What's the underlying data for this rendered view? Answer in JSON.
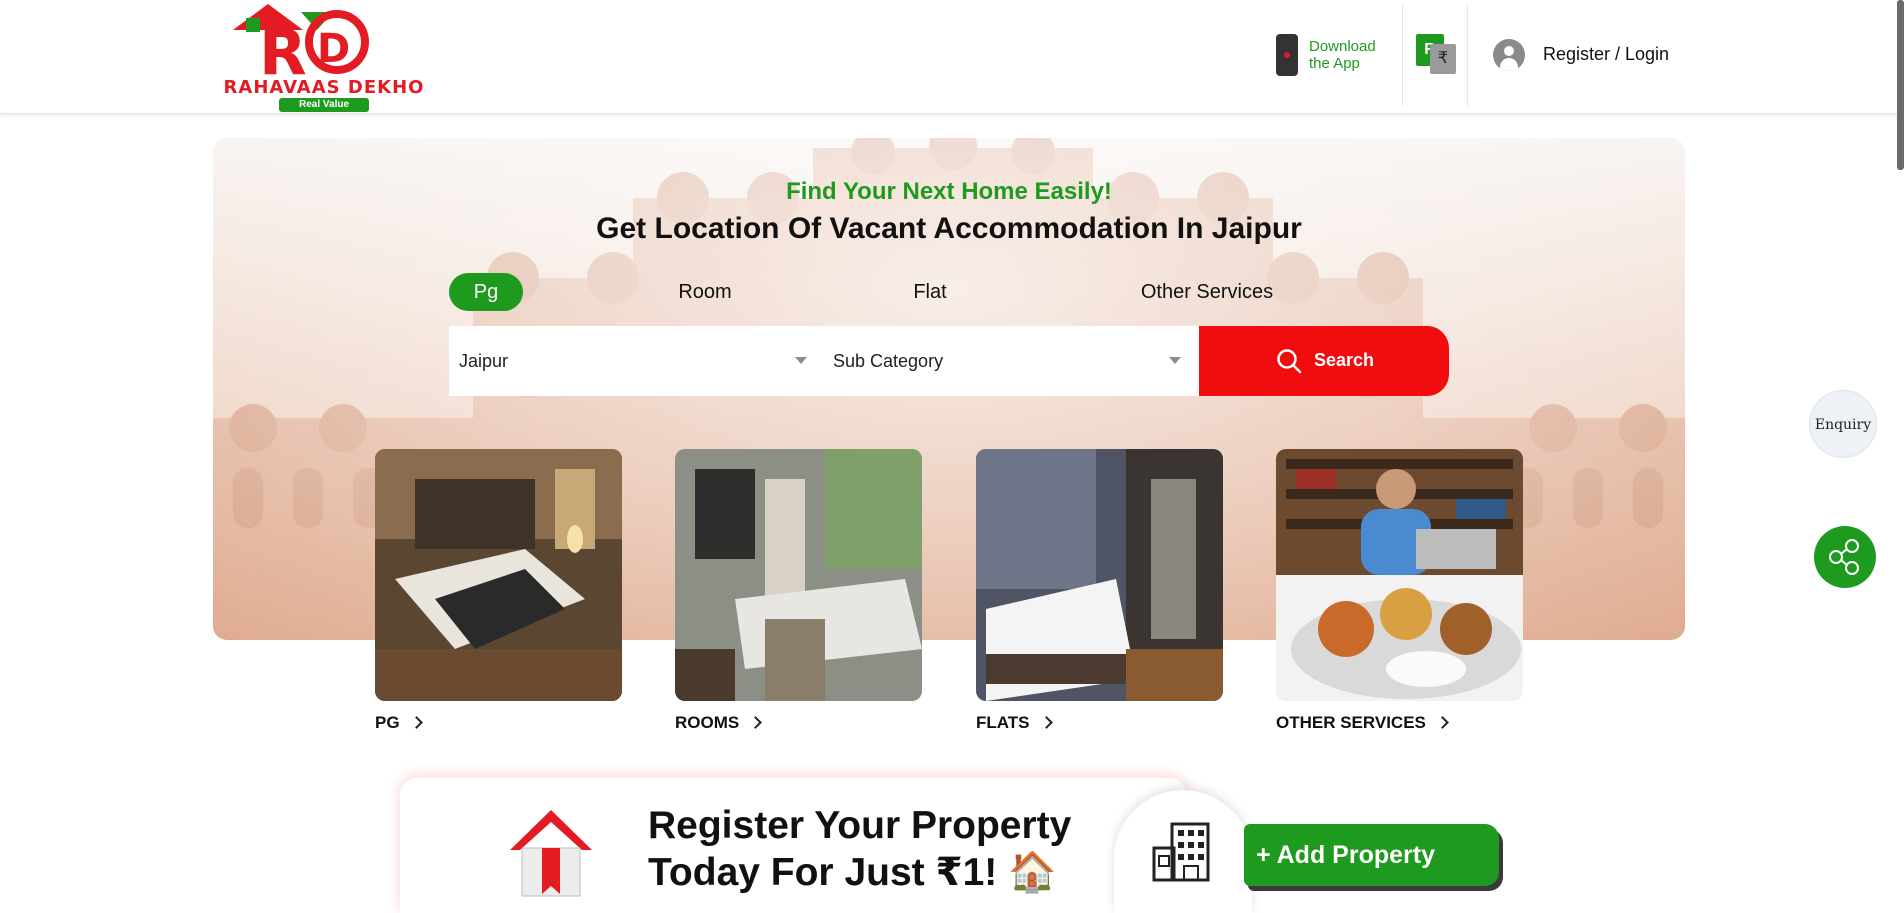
{
  "header": {
    "logo_text": "RAHAVAAS DEKHO",
    "logo_tagline": "Real Value",
    "download_label": "Download the App",
    "register_login": "Register / Login"
  },
  "hero": {
    "tagline": "Find Your Next Home Easily!",
    "headline": "Get Location Of Vacant Accommodation In Jaipur",
    "tabs": [
      {
        "label": "Pg",
        "active": true
      },
      {
        "label": "Room",
        "active": false
      },
      {
        "label": "Flat",
        "active": false
      },
      {
        "label": "Other Services",
        "active": false
      }
    ],
    "city_select": {
      "value": "Jaipur"
    },
    "subcategory_select": {
      "value": "Sub Category"
    },
    "search_label": "Search"
  },
  "categories": [
    {
      "label": "PG",
      "image": "bedroom-photo"
    },
    {
      "label": "ROOMS",
      "image": "hotel-room-photo"
    },
    {
      "label": "FLATS",
      "image": "flat-bedroom-photo"
    },
    {
      "label": "OTHER SERVICES",
      "image": "library-and-meal-photo"
    }
  ],
  "floating": {
    "enquiry_label": "Enquiry",
    "share_icon": "share-icon"
  },
  "register_banner": {
    "line1": "Register Your Property",
    "line2": "Today For Just ₹1! 🏠",
    "add_button_label": "+ Add Property"
  },
  "colors": {
    "brand_green": "#1e9a1e",
    "brand_red": "#f10d0d"
  }
}
